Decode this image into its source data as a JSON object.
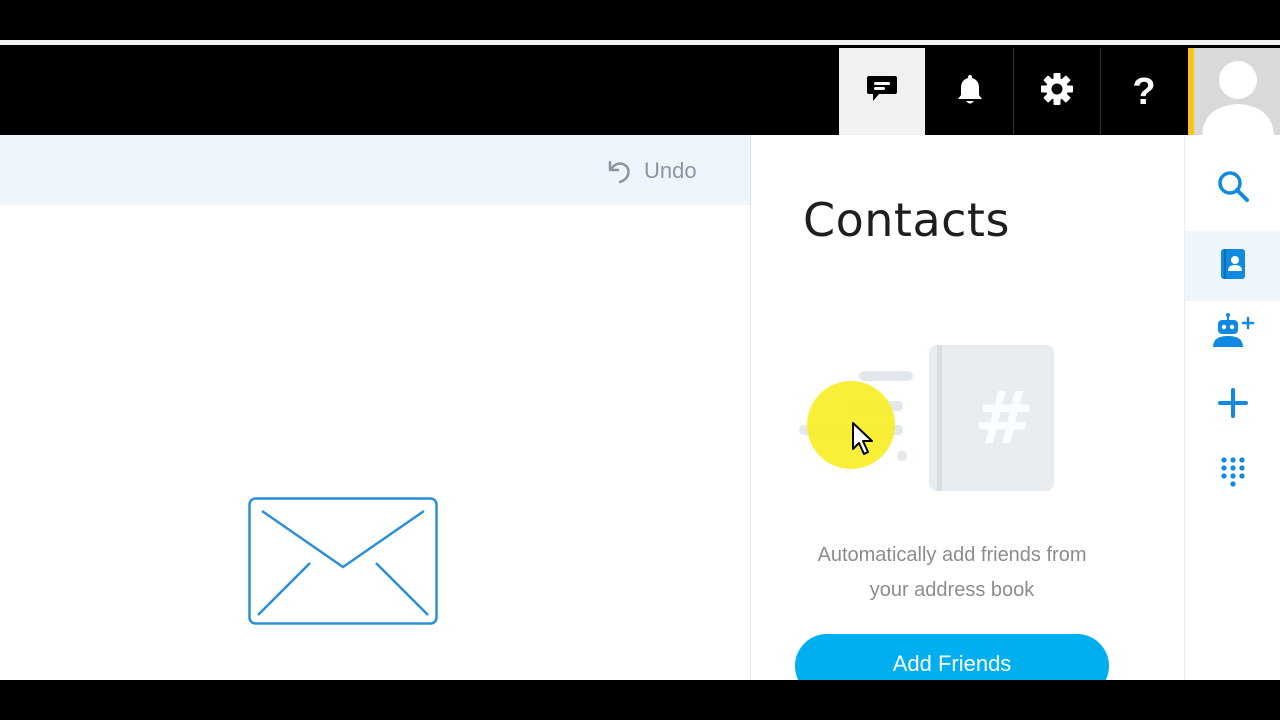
{
  "header": {
    "chat_icon": "chat-bubble-icon",
    "notifications_icon": "bell-icon",
    "settings_icon": "gear-icon",
    "help_icon": "question-mark-icon",
    "profile_icon": "user-avatar-icon"
  },
  "left_panel": {
    "undo_label": "Undo",
    "empty_state_icon": "envelope-icon"
  },
  "contacts_panel": {
    "title": "Contacts",
    "hint_line1": "Automatically add friends from",
    "hint_line2": "your address book",
    "add_friends_label": "Add Friends",
    "illustration_icon": "address-book-icon"
  },
  "right_rail": {
    "items": [
      {
        "icon": "search-icon"
      },
      {
        "icon": "contacts-book-icon",
        "active": true
      },
      {
        "icon": "add-bot-icon"
      },
      {
        "icon": "plus-icon"
      },
      {
        "icon": "dialpad-icon"
      }
    ]
  },
  "colors": {
    "accent": "#00aff0",
    "header_bg": "#000000",
    "profile_border": "#f5c518",
    "highlight": "#f8ee28",
    "undo_bar_bg": "#eef5fc"
  }
}
